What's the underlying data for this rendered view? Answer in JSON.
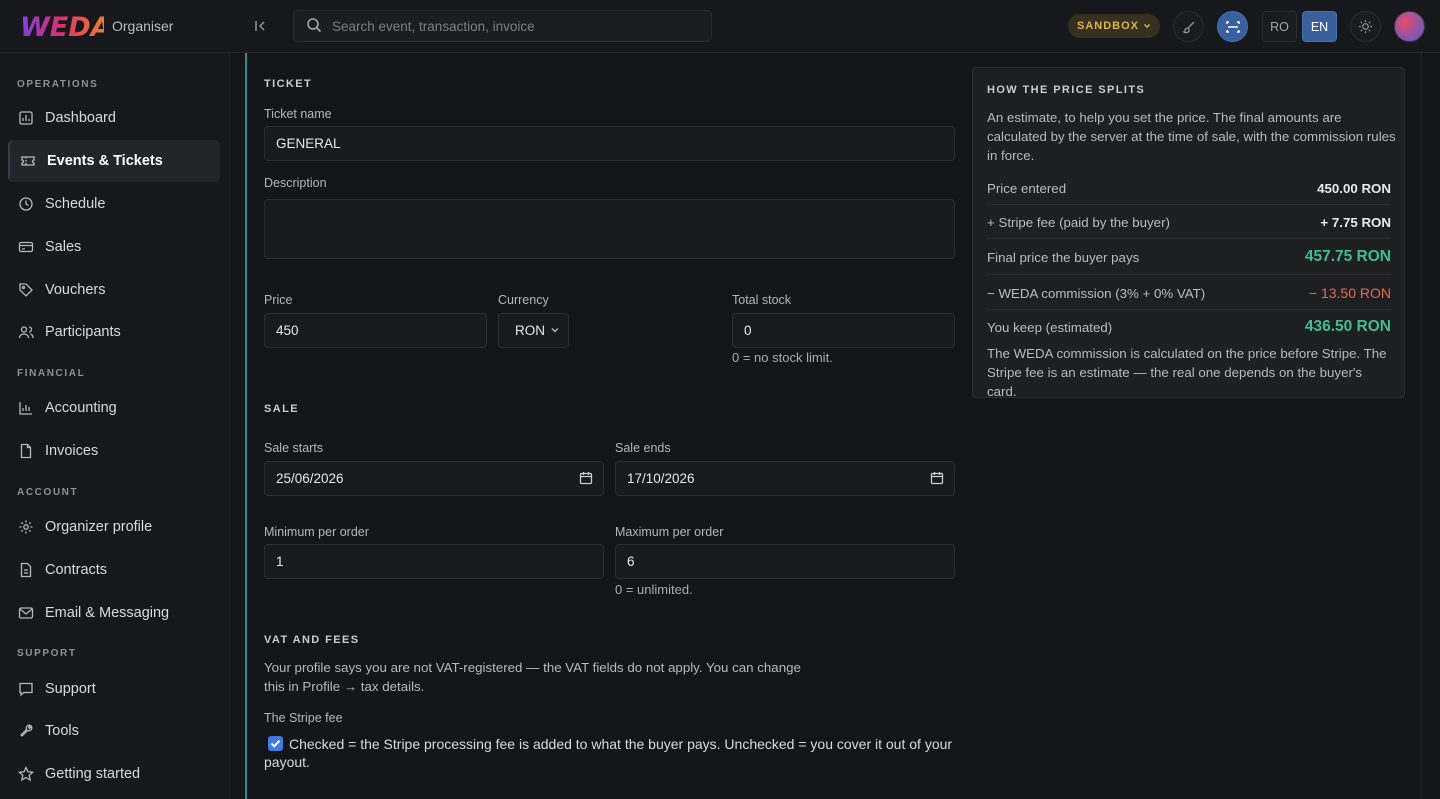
{
  "app": {
    "logo_text": "WEDA",
    "org_label": "Organiser"
  },
  "header": {
    "search_placeholder": "Search event, transaction, invoice",
    "env_badge": "SANDBOX",
    "lang_ro": "RO",
    "lang_en": "EN",
    "active_lang": "EN",
    "colors": {
      "accent": "#2a8f86",
      "sandbox": "#e0b44a",
      "lang_active": "#3a5f9e"
    }
  },
  "sidebar": {
    "sections": [
      {
        "label": "OPERATIONS",
        "items": [
          {
            "label": "Dashboard",
            "icon": "dashboard-icon"
          },
          {
            "label": "Events & Tickets",
            "icon": "ticket-icon",
            "active": true
          },
          {
            "label": "Schedule",
            "icon": "clock-icon"
          },
          {
            "label": "Sales",
            "icon": "card-icon"
          },
          {
            "label": "Vouchers",
            "icon": "tag-icon"
          },
          {
            "label": "Participants",
            "icon": "users-icon"
          }
        ]
      },
      {
        "label": "FINANCIAL",
        "items": [
          {
            "label": "Accounting",
            "icon": "chart-icon"
          },
          {
            "label": "Invoices",
            "icon": "file-icon"
          }
        ]
      },
      {
        "label": "ACCOUNT",
        "items": [
          {
            "label": "Organizer profile",
            "icon": "gear-icon"
          },
          {
            "label": "Contracts",
            "icon": "document-icon"
          },
          {
            "label": "Email & Messaging",
            "icon": "mail-icon"
          }
        ]
      },
      {
        "label": "SUPPORT",
        "items": [
          {
            "label": "Support",
            "icon": "chat-icon"
          },
          {
            "label": "Tools",
            "icon": "wrench-icon"
          },
          {
            "label": "Getting started",
            "icon": "star-icon"
          }
        ]
      }
    ]
  },
  "form": {
    "ticket_section": "TICKET",
    "ticket_name_label": "Ticket name",
    "ticket_name_value": "GENERAL",
    "description_label": "Description",
    "description_value": "",
    "price_label": "Price",
    "price_value": "450",
    "currency_label": "Currency",
    "currency_value": "RON",
    "stock_label": "Total stock",
    "stock_value": "0",
    "stock_hint": "0 = no stock limit.",
    "sale_section": "SALE",
    "sale_starts_label": "Sale starts",
    "sale_starts_value": "25/06/2026",
    "sale_ends_label": "Sale ends",
    "sale_ends_value": "17/10/2026",
    "min_label": "Minimum per order",
    "min_value": "1",
    "max_label": "Maximum per order",
    "max_value": "6",
    "max_hint": "0 = unlimited.",
    "vat_section": "VAT AND FEES",
    "vat_text": "Your profile says you are not VAT-registered — the VAT fields do not apply. You can change this in Profile → tax details.",
    "stripe_label": "The Stripe fee",
    "stripe_checked": true,
    "stripe_text": "Checked = the Stripe processing fee is added to what the buyer pays. Unchecked = you cover it out of your payout."
  },
  "split": {
    "title": "HOW THE PRICE SPLITS",
    "intro": "An estimate, to help you set the price. The final amounts are calculated by the server at the time of sale, with the commission rules in force.",
    "rows": [
      {
        "label": "Price entered",
        "value": "450.00 RON"
      },
      {
        "label": "+ Stripe fee (paid by the buyer)",
        "value": "+ 7.75 RON"
      },
      {
        "label": "Final price the buyer pays",
        "value": "457.75 RON"
      },
      {
        "label": "− WEDA commission (3% + 0% VAT)",
        "value": "− 13.50 RON"
      },
      {
        "label": "You keep (estimated)",
        "value": "436.50 RON"
      }
    ],
    "note": "The WEDA commission is calculated on the price before Stripe. The Stripe fee is an estimate — the real one depends on the buyer's card."
  }
}
